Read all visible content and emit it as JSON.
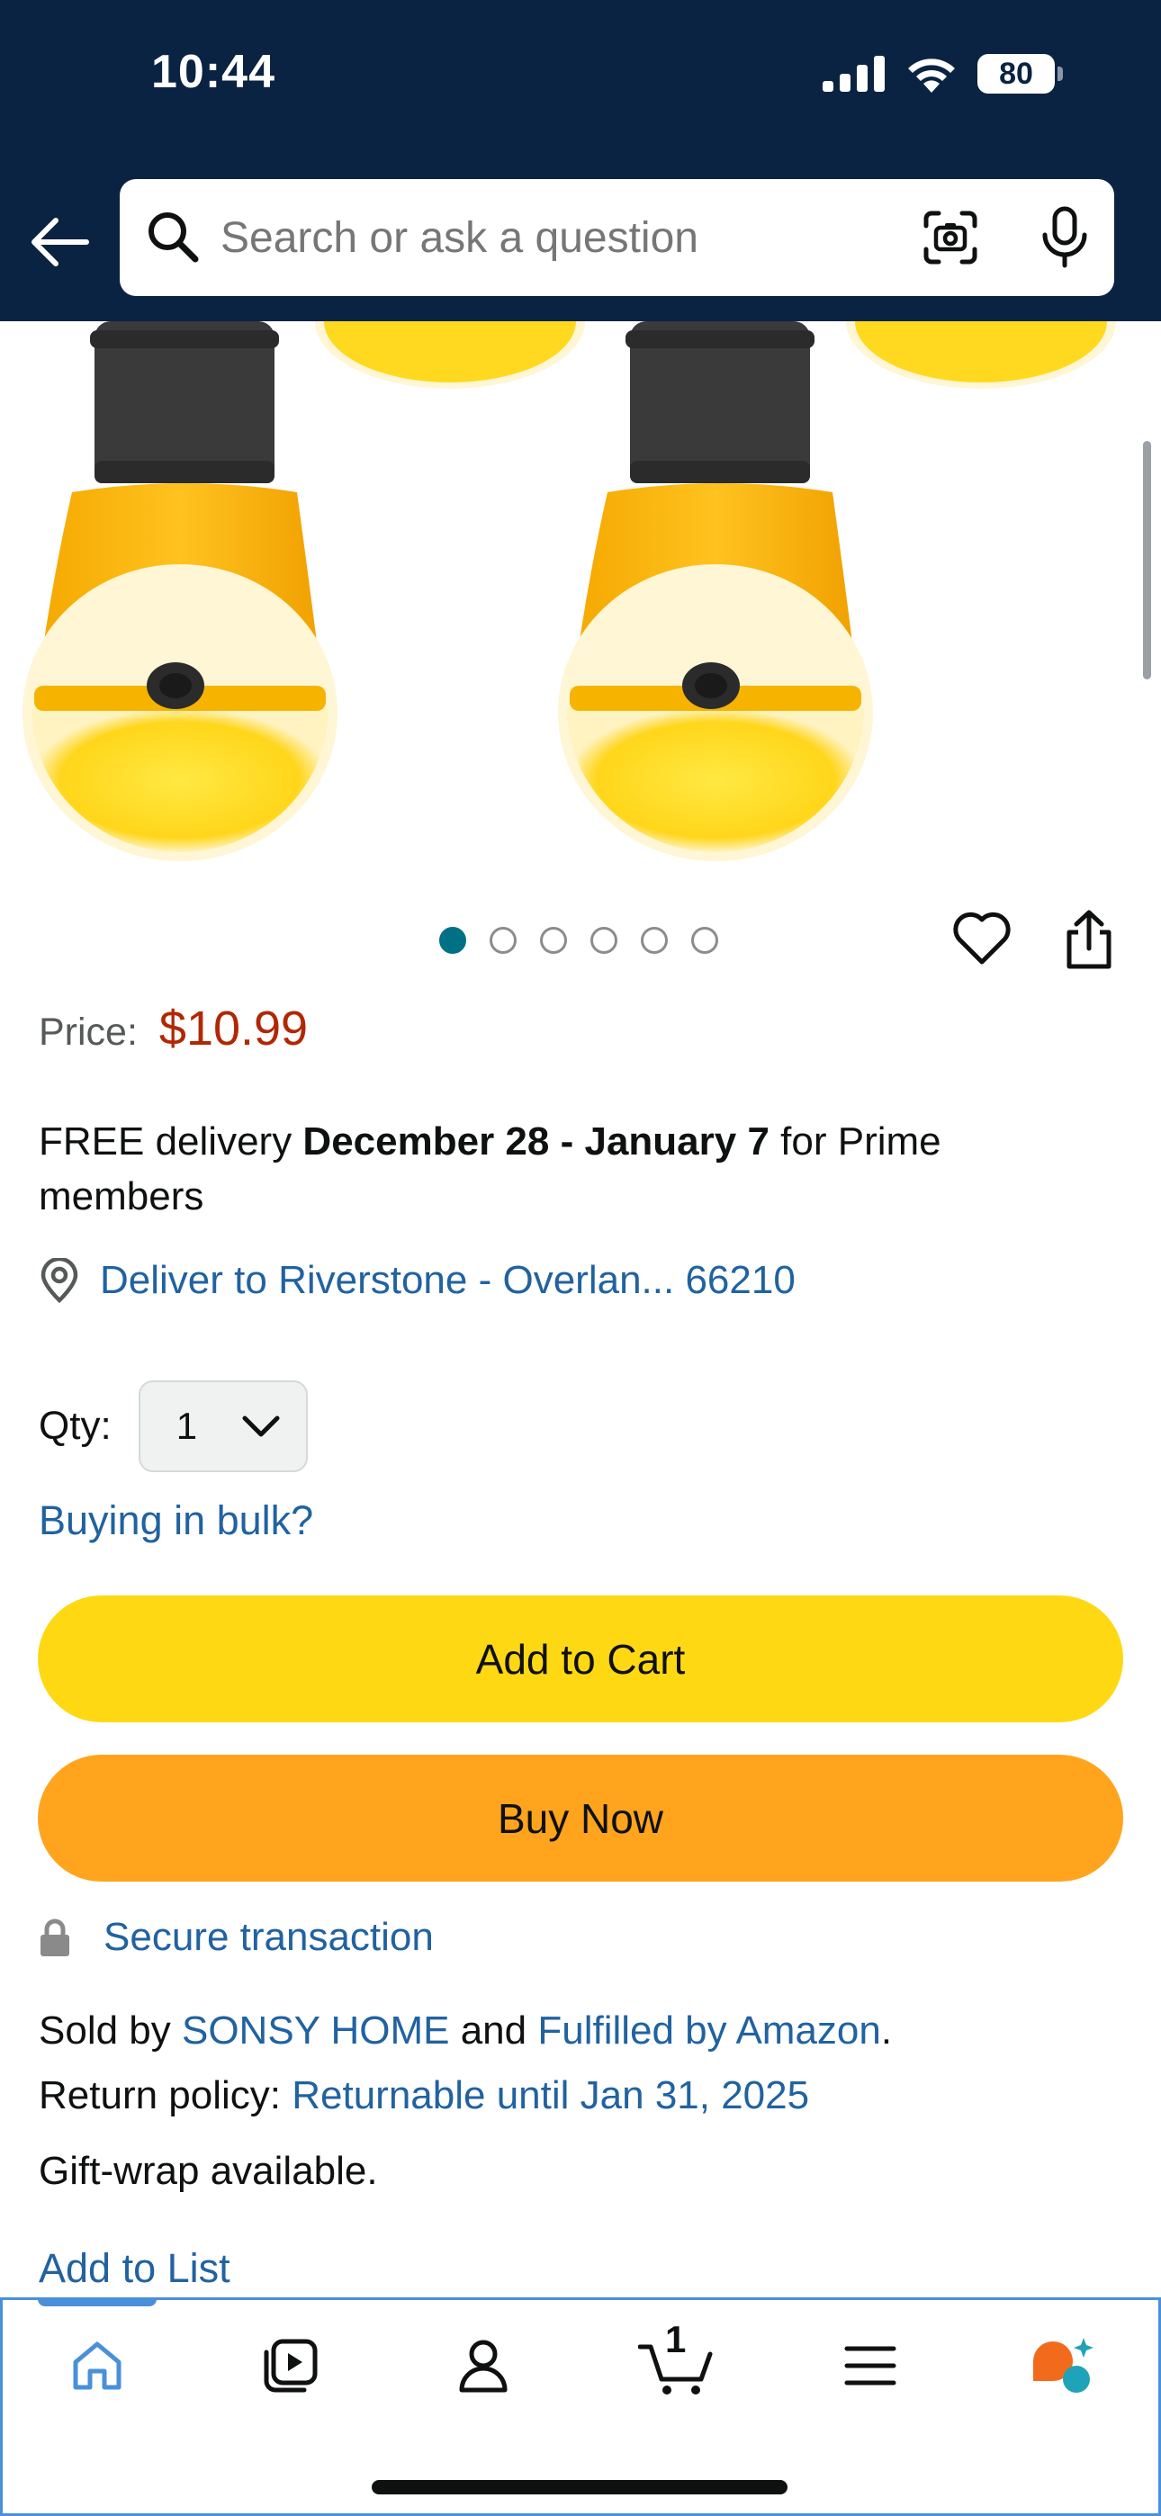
{
  "status_bar": {
    "time": "10:44",
    "battery": "80"
  },
  "search": {
    "placeholder": "Search or ask a question"
  },
  "image_carousel": {
    "total_images": 6,
    "active_index": 0
  },
  "price": {
    "label": "Price:",
    "value": "$10.99"
  },
  "delivery": {
    "prefix": "FREE delivery ",
    "dates": "December 28 - January 7",
    "suffix": " for Prime members"
  },
  "location": {
    "text": "Deliver to Riverstone - Overlan... 66210"
  },
  "quantity": {
    "label": "Qty:",
    "value": "1"
  },
  "bulk": {
    "label": "Buying in bulk?"
  },
  "buttons": {
    "add_to_cart": "Add to Cart",
    "buy_now": "Buy Now"
  },
  "secure": {
    "label": "Secure transaction"
  },
  "sold_by": {
    "prefix": "Sold by ",
    "seller": "SONSY HOME",
    "middle": " and ",
    "fulfillment": "Fulfilled by Amazon",
    "suffix": "."
  },
  "return_policy": {
    "label": "Return policy: ",
    "value": "Returnable until Jan 31, 2025"
  },
  "gift_wrap": "Gift-wrap available.",
  "add_to_list": "Add to List",
  "tabbar": {
    "cart_count": "1"
  },
  "colors": {
    "header_bg": "#0b2342",
    "price": "#b12704",
    "link": "#2162a1",
    "add_to_cart": "#ffd814",
    "buy_now": "#ffa41c",
    "active_dot": "#007185"
  }
}
